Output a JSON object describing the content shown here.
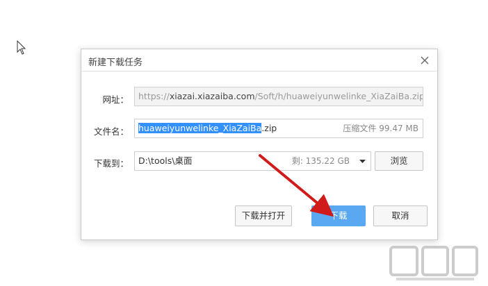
{
  "dialog": {
    "title": "新建下载任务",
    "url_label": "网址：",
    "url_prefix": "https://",
    "url_domain": "xiazai.xiazaiba.com",
    "url_path": "/Soft/h/huaweiyunwelinke_XiaZaiBa.zip",
    "filename_label": "文件名：",
    "filename_selected": "huaweiyunwelinke_XiaZaiBa",
    "filename_ext": ".zip",
    "file_info": "压缩文件 99.47 MB",
    "saveto_label": "下载到：",
    "save_path": "D:\\tools\\桌面",
    "free_space": "剩: 135.22 GB",
    "browse_label": "浏览",
    "download_open_label": "下载并打开",
    "download_label": "下载",
    "cancel_label": "取消"
  },
  "colors": {
    "primary_button": "#5aa7f2",
    "selection": "#3390ff",
    "arrow": "#d11a1a"
  },
  "icons": {
    "cursor": "mouse-cursor-icon",
    "close": "close-icon",
    "dropdown": "chevron-down-icon",
    "annotation": "red-arrow-annotation",
    "watermark": "xiazaiba-watermark-logo"
  }
}
